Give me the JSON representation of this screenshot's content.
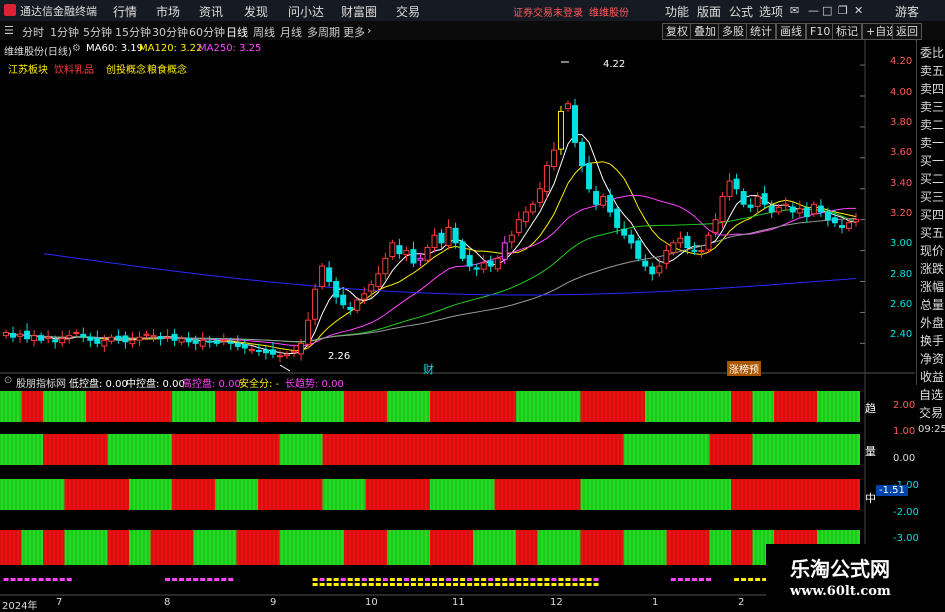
{
  "app": {
    "name": "通达信金融终端"
  },
  "menu": [
    "行情",
    "市场",
    "资讯",
    "发现",
    "问小达",
    "财富圈",
    "交易"
  ],
  "warnings": [
    "证券交易未登录",
    "维维股份"
  ],
  "right_tools": [
    "功能",
    "版面",
    "公式",
    "选项",
    "游客"
  ],
  "periods": [
    "分时",
    "1分钟",
    "5分钟",
    "15分钟",
    "30分钟",
    "60分钟",
    "日线",
    "周线",
    "月线",
    "多周期",
    "更多"
  ],
  "selected_period": "日线",
  "toolbar_buttons": [
    "复权",
    "叠加",
    "多股",
    "统计",
    "画线",
    "F10",
    "标记",
    "+自选",
    "返回"
  ],
  "stock": {
    "name_line": "维维股份(日线)",
    "ma60_label": "MA60: 3.19",
    "ma120_label": "MA120: 3.22",
    "ma250_label": "MA250: 3.25"
  },
  "concepts": [
    "江苏板块",
    "饮料乳品",
    "创投概念",
    "粮食概念"
  ],
  "right_panel": [
    "委比",
    "卖五",
    "卖四",
    "卖三",
    "卖二",
    "卖一",
    "买一",
    "买二",
    "买三",
    "买四",
    "买五",
    "现价",
    "涨跌",
    "涨幅",
    "总量",
    "外盘",
    "换手",
    "净资",
    "收益"
  ],
  "right_panel_lower": [
    "自选",
    "交易",
    "09:25"
  ],
  "price_axis": [
    "4.20",
    "4.00",
    "3.80",
    "3.60",
    "3.40",
    "3.20",
    "3.00",
    "2.80",
    "2.60",
    "2.40"
  ],
  "annotations": {
    "high": "4.22",
    "low": "2.26",
    "mark1": "财",
    "mark2": "涨榜预"
  },
  "indicator": {
    "name": "股朋指标网",
    "low": "低控盘: 0.00",
    "mid": "中控盘: 0.00",
    "high": "高控盘: 0.00",
    "safe": "安全分: -",
    "trend": "长趋势: 0.00"
  },
  "indicator_axis": [
    "2.00",
    "1.00",
    "0.00",
    "-1.00",
    "-2.00",
    "-3.00"
  ],
  "indicator_marker": "-1.51",
  "strip_labels": [
    "趋",
    "量",
    "中"
  ],
  "date_axis": [
    "2024年",
    "7",
    "8",
    "9",
    "10",
    "11",
    "12",
    "1",
    "2"
  ],
  "watermark": {
    "line1": "乐淘公式网",
    "line2": "www.60lt.com"
  },
  "colors": {
    "up": "#ff3b3b",
    "down": "#00e0e0",
    "green": "#22dd22",
    "red": "#ee1111",
    "ma_blue": "#2a2aff",
    "yellow": "#ffee00",
    "magenta": "#ff44ff"
  },
  "chart_data": {
    "type": "candlestick",
    "y_axis_range": [
      2.26,
      4.22
    ],
    "close_trend": [
      2.47,
      2.44,
      2.46,
      2.43,
      2.45,
      2.42,
      2.44,
      2.41,
      2.43,
      2.45,
      2.47,
      2.44,
      2.42,
      2.4,
      2.42,
      2.44,
      2.43,
      2.41,
      2.42,
      2.44,
      2.46,
      2.45,
      2.43,
      2.44,
      2.42,
      2.43,
      2.41,
      2.4,
      2.42,
      2.41,
      2.4,
      2.42,
      2.4,
      2.38,
      2.37,
      2.36,
      2.35,
      2.34,
      2.33,
      2.32,
      2.33,
      2.35,
      2.4,
      2.55,
      2.75,
      2.9,
      2.8,
      2.7,
      2.65,
      2.62,
      2.68,
      2.72,
      2.78,
      2.85,
      2.95,
      3.05,
      2.98,
      3.0,
      2.92,
      2.95,
      3.02,
      3.1,
      3.05,
      3.15,
      3.05,
      2.95,
      2.9,
      2.88,
      2.92,
      2.9,
      2.95,
      3.05,
      3.1,
      3.2,
      3.25,
      3.3,
      3.4,
      3.55,
      3.65,
      3.9,
      3.95,
      3.7,
      3.55,
      3.4,
      3.3,
      3.35,
      3.25,
      3.15,
      3.1,
      3.05,
      2.95,
      2.9,
      2.85,
      2.9,
      3.0,
      3.05,
      3.08,
      3.02,
      3.0,
      3.0,
      3.1,
      3.2,
      3.35,
      3.45,
      3.4,
      3.3,
      3.28,
      3.35,
      3.3,
      3.25,
      3.28,
      3.3,
      3.25,
      3.27,
      3.22,
      3.3,
      3.25,
      3.2,
      3.18,
      3.15,
      3.18,
      3.2
    ]
  }
}
